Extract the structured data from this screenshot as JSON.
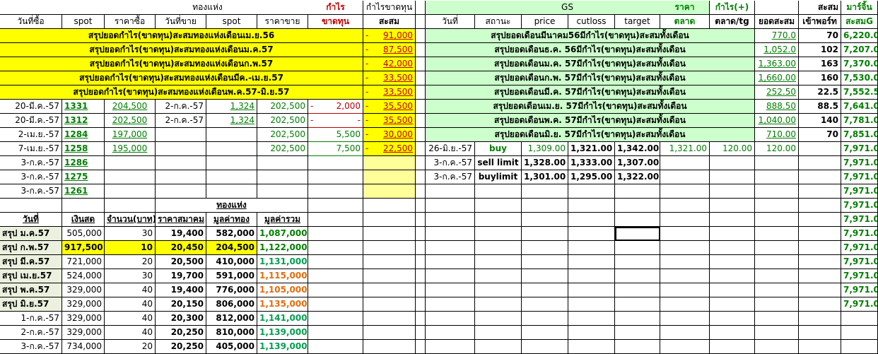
{
  "header": {
    "gold_group": "ทองแห่ง",
    "profit": "กำไร",
    "loss": "ขาดทุน",
    "profit_loss": "กำไรขาดทุน",
    "cumulative": "สะสม",
    "gs": "GS",
    "price_label": "ราคา",
    "market": "ตลาด",
    "profit_plus": "กำไร(+)",
    "market_tg": "ตลาด/tg",
    "total_cum": "ยอดสะสม",
    "port_in": "เข้าพอร์ท",
    "margin": "มาร์จิ้น",
    "cumG": "สะสมG",
    "cum2": "สะสม",
    "col_buydate": "วันที่ซื้อ",
    "col_spot": "spot",
    "col_buyprice": "ราคาซื้อ",
    "col_selldate": "วันที่ขาย",
    "col_spot2": "spot",
    "col_sellprice": "ราคาขาย",
    "col_date": "วันที่",
    "col_status": "สถานะ",
    "col_price": "price",
    "col_cutloss": "cutloss",
    "col_target": "target"
  },
  "summary_left": [
    {
      "label": "สรุปยอดกำไร(ขาดทุน)สะสมทองแห่งเดือนเม.ย.56",
      "value": "91,000"
    },
    {
      "label": "สรุปยอดกำไร(ขาดทุน)สะสมทองแห่งเดือนม.ค.57",
      "value": "87,500"
    },
    {
      "label": "สรุปยอดกำไร(ขาดทุน)สะสมทองแห่งเดือนก.พ.57",
      "value": "42,000"
    },
    {
      "label": "สรุปยอดกำไร(ขาดทุน)สะสมทองแห่งเดือนมีค.-เม.ย.57",
      "value": "33,500"
    },
    {
      "label": "สรุปยอดกำไร(ขาดทุน)สะสมทองแห่งเดือนพ.ค.57-มิ.ย.57",
      "value": "33,500"
    }
  ],
  "trades": [
    {
      "buydate": "20-มี.ค.-57",
      "spot": "1331",
      "buyprice": "204,500",
      "selldate": "2-ก.ค.-57",
      "spot2": "1,324",
      "sellprice": "202,500",
      "pl": "2,000",
      "cum": "35,500"
    },
    {
      "buydate": "20-มี.ค.-57",
      "spot": "1312",
      "buyprice": "202,500",
      "selldate": "2-ก.ค.-57",
      "spot2": "1,324",
      "sellprice": "202,500",
      "pl": "-",
      "cum": "35,500"
    },
    {
      "buydate": "2-เม.ย.-57",
      "spot": "1284",
      "buyprice": "197,000",
      "selldate": "",
      "spot2": "",
      "sellprice": "202,500",
      "pl": "5,500",
      "cum": "30,000"
    },
    {
      "buydate": "7-เม.ย.-57",
      "spot": "1258",
      "buyprice": "195,000",
      "selldate": "",
      "spot2": "",
      "sellprice": "202,500",
      "pl": "7,500",
      "cum": "22,500"
    },
    {
      "buydate": "3-ก.ค.-57",
      "spot": "1286"
    },
    {
      "buydate": "3-ก.ค.-57",
      "spot": "1275"
    },
    {
      "buydate": "3-ก.ค.-57",
      "spot": "1261"
    }
  ],
  "gs_summary": [
    {
      "label": "สรุปยอดเดือนมีนาคม56มีกำไร(ขาดทุน)สะสมทั้งเดือน",
      "total": "770.0",
      "port": "70",
      "cumg": "6,220.0"
    },
    {
      "label": "สรุปยอดเดือนธ.ค. 56มีกำไร(ขาดทุน)สะสมทั้งเดือน",
      "total": "1,052.0",
      "port": "102",
      "cumg": "7,207.0"
    },
    {
      "label": "สรุปยอดเดือนม.ค. 57มีกำไร(ขาดทุน)สะสมทั้งเดือน",
      "total": "1,363.00",
      "port": "163",
      "cumg": "7,370.0"
    },
    {
      "label": "สรุปยอดเดือนก.พ. 57มีกำไร(ขาดทุน)สะสมทั้งเดือน",
      "total": "1,660.00",
      "port": "160",
      "cumg": "7,530.0"
    },
    {
      "label": "สรุปยอดเดือนมี.ค. 57มีกำไร(ขาดทุน)สะสมทั้งเดือน",
      "total": "252.50",
      "port": "22.5",
      "cumg": "7,552.5"
    },
    {
      "label": "สรุปยอดเดือนเม.ย. 57มีกำไร(ขาดทุน)สะสมทั้งเดือน",
      "total": "888.50",
      "port": "88.5",
      "cumg": "7,641.0"
    },
    {
      "label": "สรุปยอดเดือนพ.ค. 57มีกำไร(ขาดทุน)สะสมทั้งเดือน",
      "total": "1,040.00",
      "port": "140",
      "cumg": "7,781.0"
    },
    {
      "label": "สรุปยอดเดือนมิ.ย. 57มีกำไร(ขาดทุน)สะสมทั้งเดือน",
      "total": "710.00",
      "port": "70",
      "cumg": "7,851.0"
    }
  ],
  "gs_orders": [
    {
      "date": "26-มิ.ย.-57",
      "status": "buy",
      "price": "1,309.00",
      "cutloss": "1,321.00",
      "target": "1,342.00",
      "market": "1,321.00",
      "profit": "120.00",
      "mtg": "120.00",
      "cumg": "7,971.0"
    },
    {
      "date": "3-ก.ค.-57",
      "status": "sell limit",
      "price": "1,328.00",
      "cutloss": "1,333.00",
      "target": "1,307.00",
      "cumg": "7,971.0"
    },
    {
      "date": "3-ก.ค.-57",
      "status": "buylimit",
      "price": "1,301.00",
      "cutloss": "1,295.00",
      "target": "1,322.00",
      "cumg": "7,971.0"
    }
  ],
  "cumg_tail": "7,971.0",
  "gold_table": {
    "title": "ทองแห่ง",
    "headers": [
      "วันที่",
      "เงินสด",
      "จำนวน(บาท)",
      "ราคาสมาคม",
      "มูลค่าทอง",
      "มูลค่ารวม"
    ],
    "rows": [
      {
        "date": "สรุป ม.ค.57",
        "cash": "505,000",
        "qty": "30",
        "price": "19,400",
        "gold": "582,000",
        "total": "1,087,000",
        "tc": "g",
        "hl": false
      },
      {
        "date": "สรุป ก.พ.57",
        "cash": "917,500",
        "qty": "10",
        "price": "20,450",
        "gold": "204,500",
        "total": "1,122,000",
        "tc": "g",
        "hl": true
      },
      {
        "date": "สรุป มี.ค.57",
        "cash": "721,000",
        "qty": "20",
        "price": "20,500",
        "gold": "410,000",
        "total": "1,131,000",
        "tc": "lg",
        "hl": false
      },
      {
        "date": "สรุป เม.ย.57",
        "cash": "524,000",
        "qty": "30",
        "price": "19,700",
        "gold": "591,000",
        "total": "1,115,000",
        "tc": "o",
        "hl": false
      },
      {
        "date": "สรุป พ.ค.57",
        "cash": "329,000",
        "qty": "40",
        "price": "19,400",
        "gold": "776,000",
        "total": "1,105,000",
        "tc": "o",
        "hl": false
      },
      {
        "date": "สรุป มิ.ย.57",
        "cash": "329,000",
        "qty": "40",
        "price": "20,150",
        "gold": "806,000",
        "total": "1,135,000",
        "tc": "o",
        "hl": false
      },
      {
        "date": "1-ก.ค.-57",
        "cash": "329,000",
        "qty": "40",
        "price": "20,300",
        "gold": "812,000",
        "total": "1,141,000",
        "tc": "lg",
        "hl": false
      },
      {
        "date": "2-ก.ค.-57",
        "cash": "329,000",
        "qty": "40",
        "price": "20,250",
        "gold": "810,000",
        "total": "1,139,000",
        "tc": "lg",
        "hl": false
      },
      {
        "date": "3-ก.ค.-57",
        "cash": "734,000",
        "qty": "20",
        "price": "20,250",
        "gold": "405,000",
        "total": "1,139,000",
        "tc": "lg",
        "hl": false
      }
    ]
  },
  "colors": {
    "yellow": "#ffff00",
    "pale_yellow": "#ffff99",
    "green_fill": "#ccffcc",
    "green_text": "#008000",
    "red_text": "#c00000",
    "orange_text": "#e46c0a"
  }
}
